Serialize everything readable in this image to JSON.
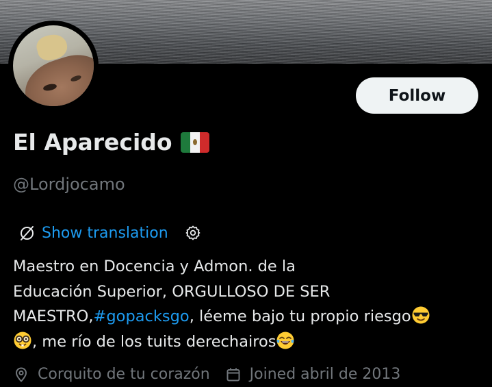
{
  "profile": {
    "display_name": "El Aparecido",
    "handle": "@Lordjocamo",
    "follow_label": "Follow"
  },
  "translation": {
    "label": "Show translation"
  },
  "bio": {
    "line1": "Maestro en Docencia y Admon. de la",
    "line2": "Educación Superior, ORGULLOSO DE SER",
    "line3_prefix": "MAESTRO,",
    "hashtag": "#gopacksgo",
    "line3_suffix": ", léeme bajo tu propio riesgo",
    "line4": ", me río de los tuits derechairos"
  },
  "meta": {
    "location": "Corquito de tu corazón",
    "joined": "Joined abril de 2013"
  },
  "icons": {
    "flag": "mexico-flag-icon",
    "translate": "translate-icon",
    "settings": "gear-icon",
    "cool": "sunglasses-face-emoji",
    "nerd": "nerd-face-emoji",
    "laugh": "tears-of-joy-emoji",
    "location": "location-pin-icon",
    "calendar": "calendar-icon"
  },
  "colors": {
    "background": "#000000",
    "text": "#e7e9ea",
    "muted": "#71767b",
    "link": "#1d9bf0",
    "button_bg": "#eff3f4",
    "button_text": "#0f1419"
  }
}
